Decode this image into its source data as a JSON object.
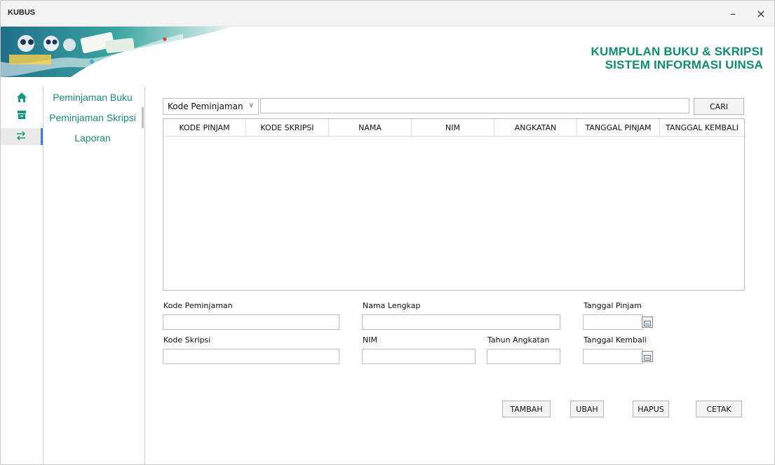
{
  "window": {
    "title": "KUBUS",
    "minimize": "–",
    "close": "×"
  },
  "brand": {
    "line1": "KUMPULAN BUKU & SKRIPSI",
    "line2": "SISTEM INFORMASI UINSA"
  },
  "iconbar": {
    "icons": [
      "home-icon",
      "archive-icon",
      "transfer-icon"
    ]
  },
  "nav": {
    "items": [
      "Peminjaman Buku",
      "Peminjaman Skripsi",
      "Laporan"
    ]
  },
  "search": {
    "field_selected": "Kode Peminjaman",
    "value": "",
    "button": "CARI"
  },
  "table": {
    "columns": [
      "KODE PINJAM",
      "KODE SKRIPSI",
      "NAMA",
      "NIM",
      "ANGKATAN",
      "TANGGAL PINJAM",
      "TANGGAL KEMBALI"
    ],
    "rows": []
  },
  "form": {
    "kode_peminjaman": {
      "label": "Kode Peminjaman",
      "value": ""
    },
    "nama_lengkap": {
      "label": "Nama Lengkap",
      "value": ""
    },
    "tanggal_pinjam": {
      "label": "Tanggal Pinjam",
      "value": ""
    },
    "kode_skripsi": {
      "label": "Kode Skripsi",
      "value": ""
    },
    "nim": {
      "label": "NIM",
      "value": ""
    },
    "tahun_angkatan": {
      "label": "Tahun Angkatan",
      "value": ""
    },
    "tanggal_kembali": {
      "label": "Tanggal Kembali",
      "value": ""
    }
  },
  "actions": {
    "tambah": "TAMBAH",
    "ubah": "UBAH",
    "hapus": "HAPUS",
    "cetak": "CETAK"
  },
  "colors": {
    "brand_green": "#0d8d73",
    "nav_green": "#158c78",
    "active_accent": "#3c7dd9"
  }
}
